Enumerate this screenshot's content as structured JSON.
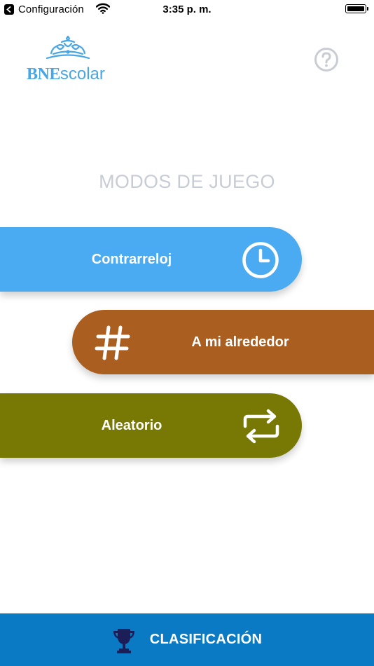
{
  "status_bar": {
    "back_app": "Configuración",
    "time": "3:35 p. m.",
    "icons": [
      "back-arrow-icon",
      "wifi-icon",
      "battery-icon"
    ]
  },
  "header": {
    "logo_bne": "BNE",
    "logo_scolar": "scolar",
    "logo_icon": "tiara-icon",
    "help_icon": "question-circle-icon"
  },
  "section_title": "MODOS DE JUEGO",
  "modes": [
    {
      "label": "Contrarreloj",
      "icon": "clock-icon",
      "color": "#4aaaf2"
    },
    {
      "label": "A mi alrededor",
      "icon": "hashtag-icon",
      "color": "#aa5e1f"
    },
    {
      "label": "Aleatorio",
      "icon": "repeat-arrows-icon",
      "color": "#787804"
    }
  ],
  "bottom_bar": {
    "label": "CLASIFICACIÓN",
    "icon": "trophy-icon",
    "color": "#0b7ac4",
    "icon_color": "#1c1f57"
  },
  "colors": {
    "logo": "#46a6e6",
    "section_title": "#c7ccd5",
    "help_icon": "#c9cdd3"
  }
}
